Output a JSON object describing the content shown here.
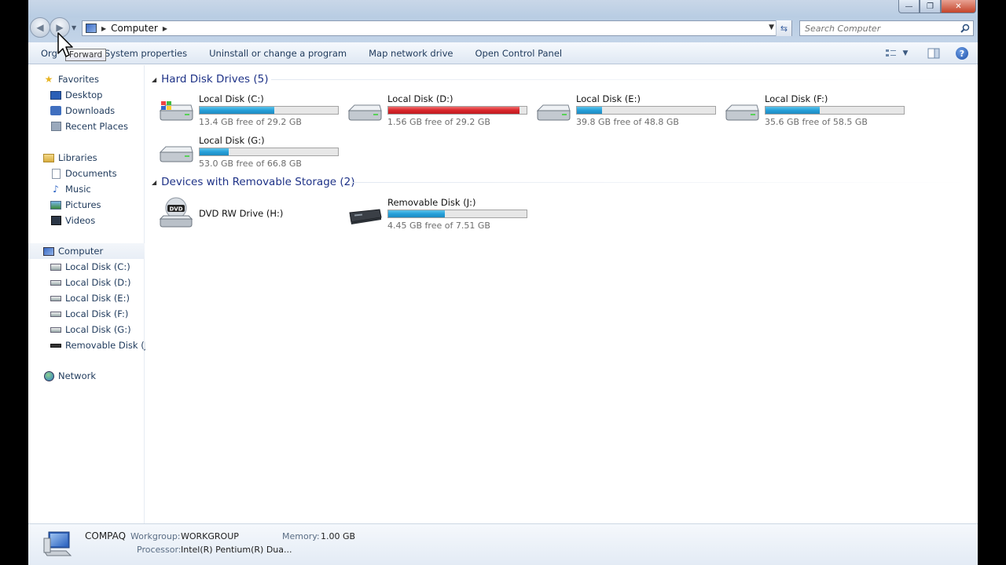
{
  "window": {
    "caption": {
      "minimize": "—",
      "maximize": "❐",
      "close": "✕"
    }
  },
  "address": {
    "location": "Computer",
    "search_placeholder": "Search Computer"
  },
  "toolbar": {
    "organize": "Org",
    "tooltip": "Forward",
    "buttons": [
      "System properties",
      "Uninstall or change a program",
      "Map network drive",
      "Open Control Panel"
    ]
  },
  "navpane": {
    "favorites": {
      "label": "Favorites",
      "items": [
        "Desktop",
        "Downloads",
        "Recent Places"
      ]
    },
    "libraries": {
      "label": "Libraries",
      "items": [
        "Documents",
        "Music",
        "Pictures",
        "Videos"
      ]
    },
    "computer": {
      "label": "Computer",
      "items": [
        "Local Disk (C:)",
        "Local Disk (D:)",
        "Local Disk (E:)",
        "Local Disk (F:)",
        "Local Disk (G:)",
        "Removable Disk (J:)"
      ]
    },
    "network": {
      "label": "Network"
    }
  },
  "content": {
    "hard_disk_header": "Hard Disk Drives (5)",
    "removable_header": "Devices with Removable Storage (2)",
    "drives": [
      {
        "name": "Local Disk (C:)",
        "free": "13.4 GB free of 29.2 GB",
        "used_fraction": 0.54,
        "full": false
      },
      {
        "name": "Local Disk (D:)",
        "free": "1.56 GB free of 29.2 GB",
        "used_fraction": 0.95,
        "full": true
      },
      {
        "name": "Local Disk (E:)",
        "free": "39.8 GB free of 48.8 GB",
        "used_fraction": 0.18,
        "full": false
      },
      {
        "name": "Local Disk (F:)",
        "free": "35.6 GB free of 58.5 GB",
        "used_fraction": 0.39,
        "full": false
      },
      {
        "name": "Local Disk (G:)",
        "free": "53.0 GB free of 66.8 GB",
        "used_fraction": 0.21,
        "full": false
      }
    ],
    "dvd": {
      "name": "DVD RW Drive (H:)",
      "badge": "DVD"
    },
    "removable": {
      "name": "Removable Disk (J:)",
      "free": "4.45 GB free of 7.51 GB",
      "used_fraction": 0.41
    }
  },
  "details": {
    "computer_name": "COMPAQ",
    "workgroup_label": "Workgroup:",
    "workgroup_value": "WORKGROUP",
    "memory_label": "Memory:",
    "memory_value": "1.00 GB",
    "processor_label": "Processor:",
    "processor_value": "Intel(R) Pentium(R) Dua..."
  },
  "colors": {
    "bar_normal": "#26a0da",
    "bar_full": "#d9262b",
    "group_header": "#1e3287",
    "nav_text": "#1e395b"
  }
}
